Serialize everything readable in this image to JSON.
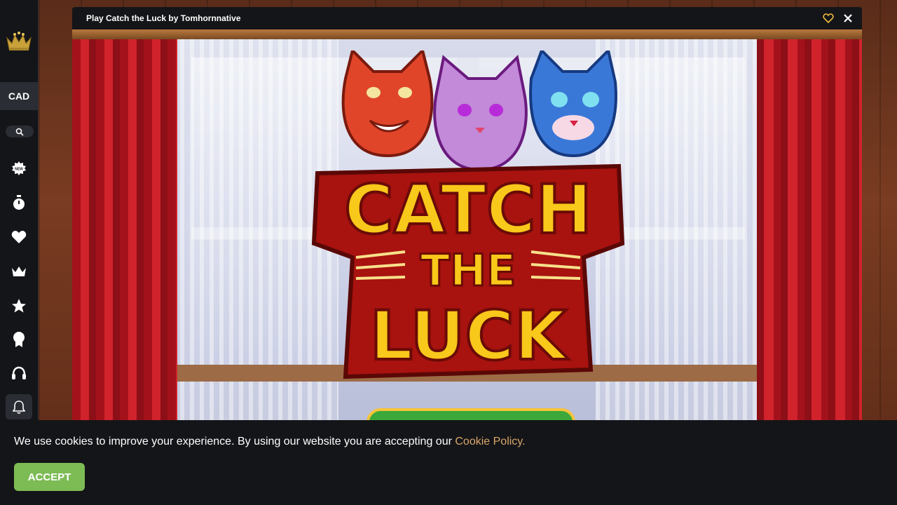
{
  "sidebar": {
    "currency": "CAD",
    "icons": [
      "crown-logo-icon",
      "search-icon",
      "new-badge-icon",
      "stopwatch-icon",
      "heart-icon",
      "crown-icon",
      "star-icon",
      "award-icon",
      "headset-icon",
      "bell-icon"
    ]
  },
  "modal": {
    "title": "Play Catch the Luck by Tomhornnative",
    "accent_color": "#f0c040"
  },
  "game": {
    "logo_line1": "CATCH",
    "logo_line2": "THE",
    "logo_line3": "LUCK"
  },
  "cookie": {
    "text": "We use cookies to improve your experience. By using our website you are accepting our",
    "link": "Cookie Policy.",
    "accept": "ACCEPT"
  },
  "colors": {
    "accept_button": "#7dbb55",
    "link": "#d9a66b",
    "dark_bg": "#141518"
  }
}
